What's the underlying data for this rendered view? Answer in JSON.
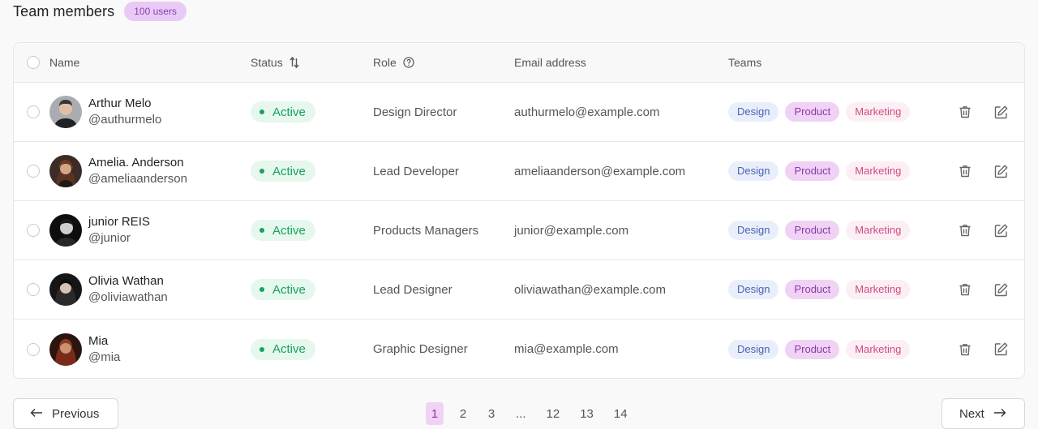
{
  "header": {
    "title": "Team members",
    "count_badge": "100 users"
  },
  "columns": {
    "name": "Name",
    "status": "Status",
    "role": "Role",
    "email": "Email address",
    "teams": "Teams"
  },
  "icons": {
    "sort": "sort-icon",
    "help": "help-circle-icon",
    "delete": "trash-icon",
    "edit": "edit-icon",
    "prev": "arrow-left-icon",
    "next": "arrow-right-icon"
  },
  "rows": [
    {
      "name": "Arthur Melo",
      "handle": "@authurmelo",
      "status": "Active",
      "role": "Design Director",
      "email": "authurmelo@example.com",
      "teams": [
        "Design",
        "Product",
        "Marketing"
      ]
    },
    {
      "name": "Amelia. Anderson",
      "handle": "@ameliaanderson",
      "status": "Active",
      "role": "Lead Developer",
      "email": "ameliaanderson@example.com",
      "teams": [
        "Design",
        "Product",
        "Marketing"
      ]
    },
    {
      "name": "junior REIS",
      "handle": "@junior",
      "status": "Active",
      "role": "Products Managers",
      "email": "junior@example.com",
      "teams": [
        "Design",
        "Product",
        "Marketing"
      ]
    },
    {
      "name": "Olivia Wathan",
      "handle": "@oliviawathan",
      "status": "Active",
      "role": "Lead Designer",
      "email": "oliviawathan@example.com",
      "teams": [
        "Design",
        "Product",
        "Marketing"
      ]
    },
    {
      "name": "Mia",
      "handle": "@mia",
      "status": "Active",
      "role": "Graphic Designer",
      "email": "mia@example.com",
      "teams": [
        "Design",
        "Product",
        "Marketing"
      ]
    }
  ],
  "pagination": {
    "previous": "Previous",
    "next": "Next",
    "pages": [
      "1",
      "2",
      "3",
      "...",
      "12",
      "13",
      "14"
    ],
    "current": "1"
  },
  "colors": {
    "accent": "#8b3aa8",
    "active_status": "#18a25d"
  }
}
